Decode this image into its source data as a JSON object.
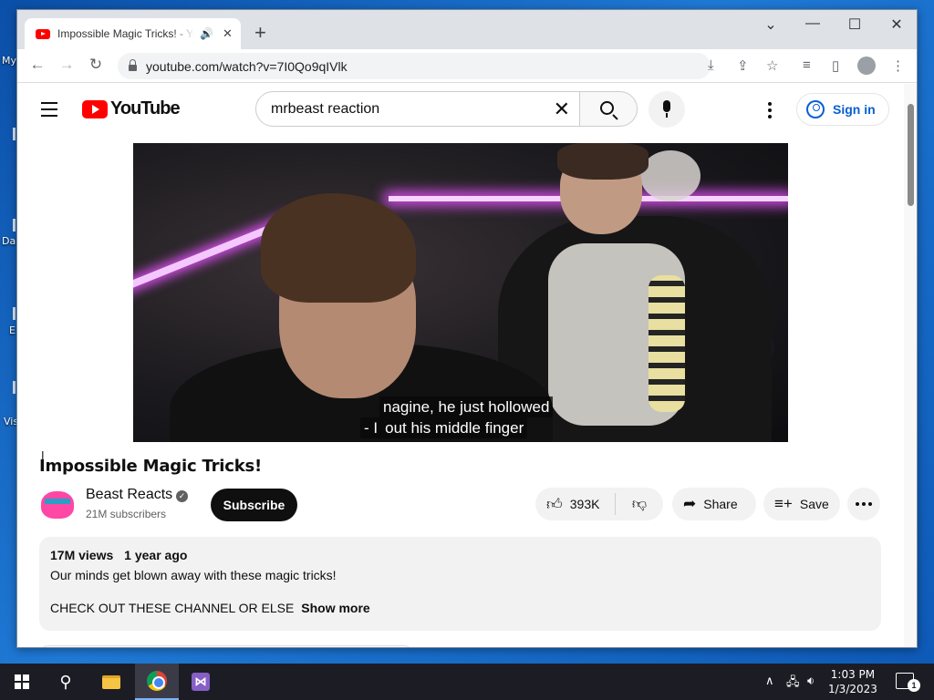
{
  "desktop": {
    "labels": [
      "My",
      "Da",
      "E",
      "Vis"
    ]
  },
  "browser": {
    "tab_title": "Impossible Magic Tricks! - Yo",
    "url": "youtube.com/watch?v=7I0Qo9qIVlk",
    "new_tab_glyph": "+",
    "tab_close_glyph": "✕",
    "audio_glyph": "🔊"
  },
  "youtube": {
    "logo_text": "YouTube",
    "search_value": "mrbeast reaction",
    "sign_in": "Sign in"
  },
  "video": {
    "caption_line1": "nagine, he just hollowed",
    "caption_line2": "out his middle finger",
    "caption_prefix": "- I",
    "title": "Impossible Magic Tricks!",
    "channel_name": "Beast Reacts",
    "subscribers": "21M subscribers",
    "subscribe_label": "Subscribe",
    "likes": "393K",
    "share_label": "Share",
    "save_label": "Save"
  },
  "description": {
    "views": "17M views",
    "age": "1 year ago",
    "line1": "Our minds get blown away with these magic tricks!",
    "line2": "CHECK OUT THESE CHANNEL OR ELSE",
    "show_more": "Show more"
  },
  "taskbar": {
    "time": "1:03 PM",
    "date": "1/3/2023",
    "notification_count": "1"
  },
  "colors": {
    "youtube_red": "#ff0000",
    "link_blue": "#065fd4",
    "taskbar": "#1c1c24"
  }
}
